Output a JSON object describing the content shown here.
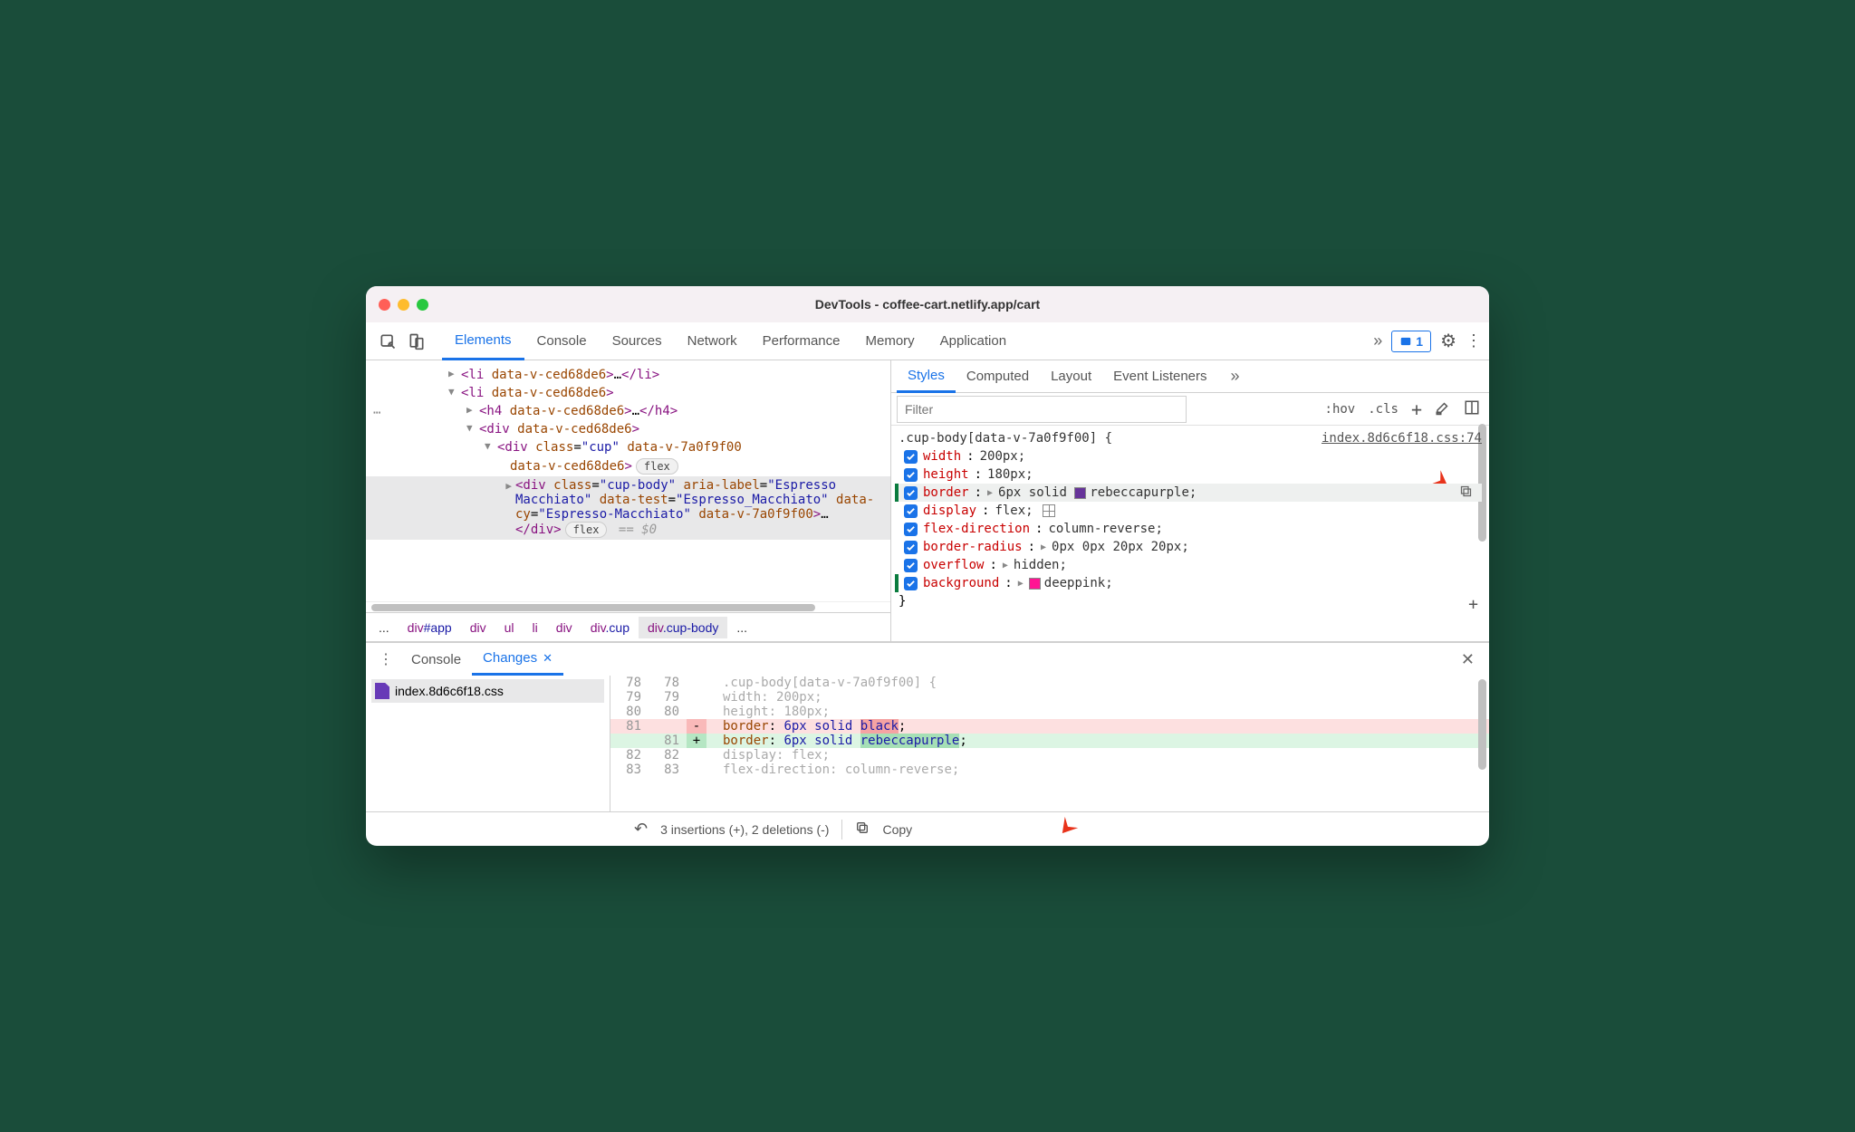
{
  "window": {
    "title": "DevTools - coffee-cart.netlify.app/cart"
  },
  "toolbar": {
    "tabs": [
      "Elements",
      "Console",
      "Sources",
      "Network",
      "Performance",
      "Memory",
      "Application"
    ],
    "active": 0,
    "issues_count": "1"
  },
  "dom": {
    "li_attr": "data-v-ced68de6",
    "cup_class": "cup",
    "cup_attrs": "data-v-7a0f9f00 data-v-ced68de6",
    "body_class": "cup-body",
    "body_aria": "aria-label=\"Espresso Macchiato\" data-test=\"Espresso_Macchiato\" data-cy=\"Espresso-Macchiato\" data-v-7a0f9f00",
    "flex_pill": "flex",
    "eq0": "== $0"
  },
  "breadcrumb": [
    {
      "t": "...",
      "plain": true
    },
    {
      "tag": "div",
      "id": "#app"
    },
    {
      "tag": "div"
    },
    {
      "tag": "ul"
    },
    {
      "tag": "li"
    },
    {
      "tag": "div"
    },
    {
      "tag": "div",
      "cls": ".cup"
    },
    {
      "tag": "div",
      "cls": ".cup-body",
      "active": true
    },
    {
      "t": "...",
      "plain": true
    }
  ],
  "styles": {
    "subTabs": [
      "Styles",
      "Computed",
      "Layout",
      "Event Listeners"
    ],
    "filter_placeholder": "Filter",
    "hov": ":hov",
    "cls": ".cls",
    "selector": ".cup-body[data-v-7a0f9f00] {",
    "source": "index.8d6c6f18.css:74",
    "props": [
      {
        "name": "width",
        "value": "200px;"
      },
      {
        "name": "height",
        "value": "180px;"
      },
      {
        "name": "border",
        "value": "6px solid ",
        "swatch": "#663399",
        "tail": "rebeccapurple;",
        "hl": true,
        "expand": true,
        "copy": true
      },
      {
        "name": "display",
        "value": "flex;",
        "grid": true
      },
      {
        "name": "flex-direction",
        "value": "column-reverse;"
      },
      {
        "name": "border-radius",
        "value": "0px 0px 20px 20px;",
        "expand": true
      },
      {
        "name": "overflow",
        "value": "hidden;",
        "expand": true
      },
      {
        "name": "background",
        "value": "",
        "swatch": "#ff1493",
        "tail": "deeppink;",
        "expand": true,
        "bg": true
      }
    ]
  },
  "drawer": {
    "tabs": [
      "Console",
      "Changes"
    ],
    "active": 1,
    "file": "index.8d6c6f18.css",
    "diff": [
      {
        "a": "78",
        "b": "78",
        "text": ".cup-body[data-v-7a0f9f00] {",
        "dim": true,
        "sel": true
      },
      {
        "a": "79",
        "b": "79",
        "prop": "width",
        "val": "200px",
        "dim": true,
        "semi": ";"
      },
      {
        "a": "80",
        "b": "80",
        "prop": "height",
        "val": "180px",
        "dim": true,
        "semi": ";"
      },
      {
        "a": "81",
        "b": "",
        "sign": "-",
        "prop": "border",
        "pre": "6px solid ",
        "hl": "black",
        "semi": ";",
        "removed": true
      },
      {
        "a": "",
        "b": "81",
        "sign": "+",
        "prop": "border",
        "pre": "6px solid ",
        "hl": "rebeccapurple",
        "semi": ";",
        "added": true
      },
      {
        "a": "82",
        "b": "82",
        "prop": "display",
        "val": "flex",
        "dim": true,
        "semi": ";"
      },
      {
        "a": "83",
        "b": "83",
        "prop": "flex-direction",
        "val": "column-reverse",
        "dim": true,
        "semi": ";"
      }
    ],
    "footer": {
      "summary": "3 insertions (+), 2 deletions (-)",
      "copy": "Copy"
    }
  }
}
